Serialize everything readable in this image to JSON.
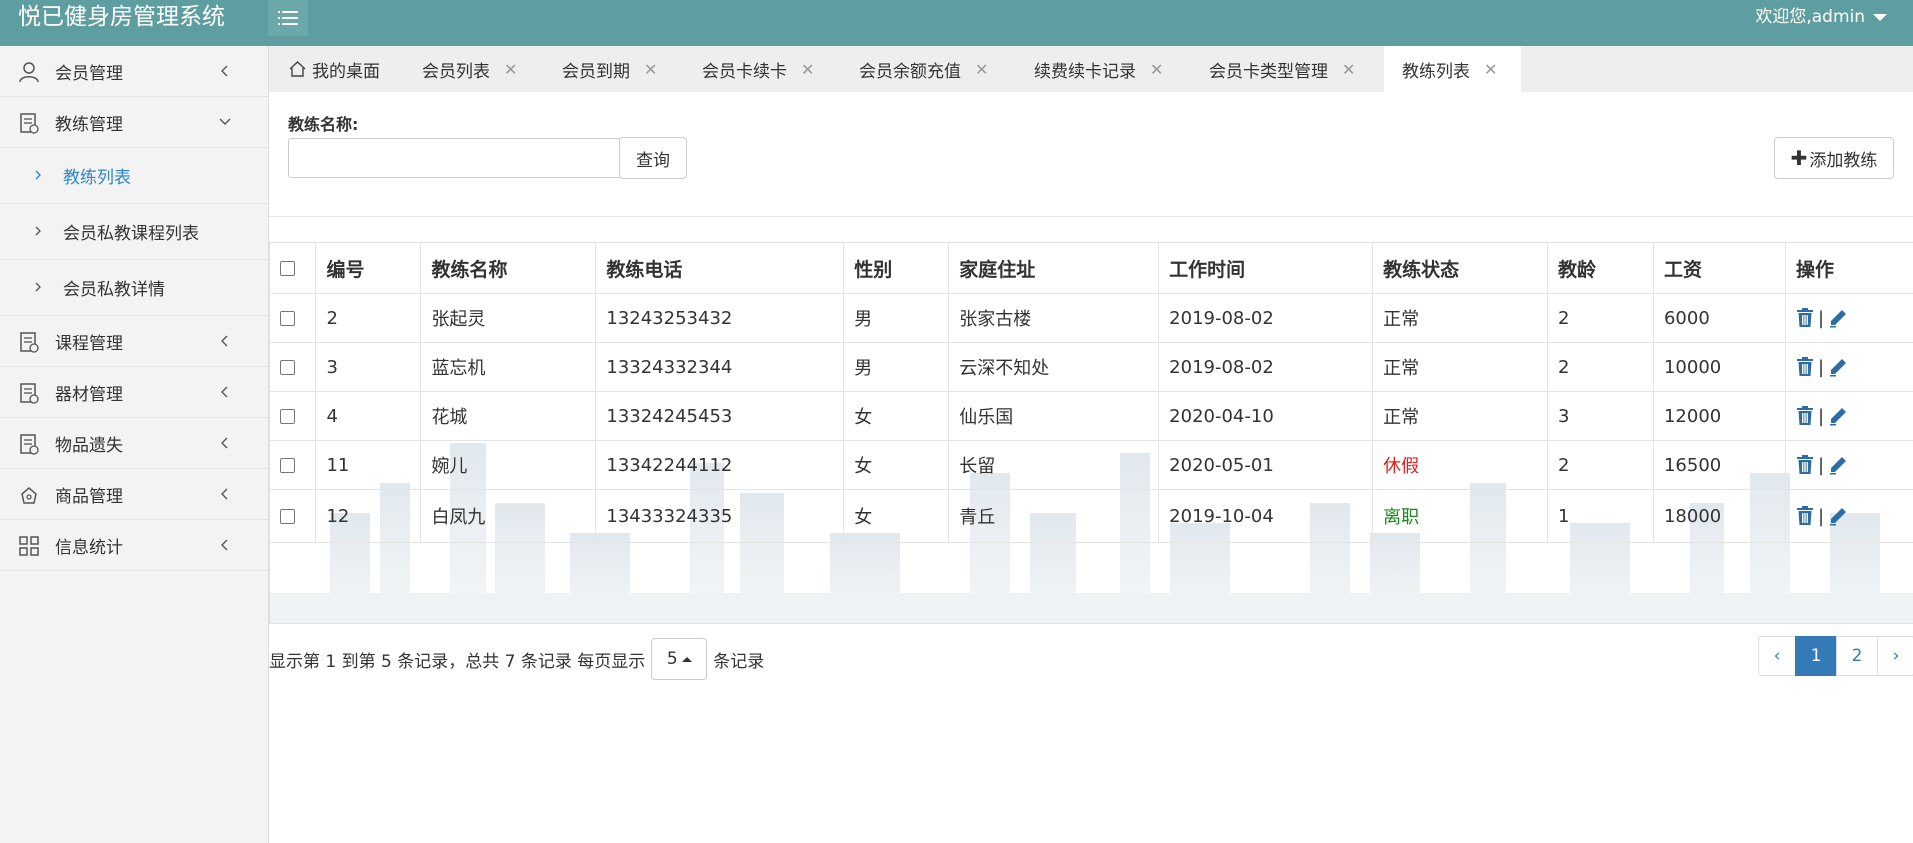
{
  "app": {
    "title": "悦已健身房管理系统",
    "welcome": "欢迎您,admin"
  },
  "sidebar": {
    "items": [
      {
        "label": "会员管理",
        "icon": "user-icon"
      },
      {
        "label": "教练管理",
        "icon": "doc-icon"
      },
      {
        "label": "课程管理",
        "icon": "doc-icon"
      },
      {
        "label": "器材管理",
        "icon": "doc-icon"
      },
      {
        "label": "物品遗失",
        "icon": "doc-icon"
      },
      {
        "label": "商品管理",
        "icon": "cart-icon"
      },
      {
        "label": "信息统计",
        "icon": "grid-icon"
      }
    ],
    "coach_sub": [
      "教练列表",
      "会员私教课程列表",
      "会员私教详情"
    ]
  },
  "tabs": [
    {
      "label": "我的桌面"
    },
    {
      "label": "会员列表"
    },
    {
      "label": "会员到期"
    },
    {
      "label": "会员卡续卡"
    },
    {
      "label": "会员余额充值"
    },
    {
      "label": "续费续卡记录"
    },
    {
      "label": "会员卡类型管理"
    },
    {
      "label": "教练列表"
    }
  ],
  "tab_close": "✕",
  "search": {
    "label": "教练名称:",
    "value": "",
    "query_button": "查询",
    "add_button": "添加教练"
  },
  "table": {
    "headers": [
      "编号",
      "教练名称",
      "教练电话",
      "性别",
      "家庭住址",
      "工作时间",
      "教练状态",
      "教龄",
      "工资",
      "操作"
    ],
    "rows": [
      {
        "id": "2",
        "name": "张起灵",
        "phone": "13243253432",
        "gender": "男",
        "address": "张家古楼",
        "work_date": "2019-08-02",
        "status": "正常",
        "years": "2",
        "salary": "6000"
      },
      {
        "id": "3",
        "name": "蓝忘机",
        "phone": "13324332344",
        "gender": "男",
        "address": "云深不知处",
        "work_date": "2019-08-02",
        "status": "正常",
        "years": "2",
        "salary": "10000"
      },
      {
        "id": "4",
        "name": "花城",
        "phone": "13324245453",
        "gender": "女",
        "address": "仙乐国",
        "work_date": "2020-04-10",
        "status": "正常",
        "years": "3",
        "salary": "12000"
      },
      {
        "id": "11",
        "name": "婉儿",
        "phone": "13342244112",
        "gender": "女",
        "address": "长留",
        "work_date": "2020-05-01",
        "status": "休假",
        "years": "2",
        "salary": "16500"
      },
      {
        "id": "12",
        "name": "白凤九",
        "phone": "13433324335",
        "gender": "女",
        "address": "青丘",
        "work_date": "2019-10-04",
        "status": "离职",
        "years": "1",
        "salary": "18000"
      }
    ],
    "action_separator": "|",
    "status_colors": {
      "正常": "#333333",
      "休假": "#e02020",
      "离职": "#1a8a1a"
    }
  },
  "pagination": {
    "info_prefix": "显示第 1 到第 5 条记录，总共 7 条记录 每页显示",
    "page_size": "5",
    "info_suffix": "条记录",
    "prev": "‹",
    "next": "›",
    "pages": [
      "1",
      "2"
    ],
    "current": "1"
  },
  "colors": {
    "header_bg": "#5f9ea0",
    "accent": "#337ab7",
    "sidebar_active": "#2e86c9",
    "icon_blue": "#2e6da4"
  }
}
